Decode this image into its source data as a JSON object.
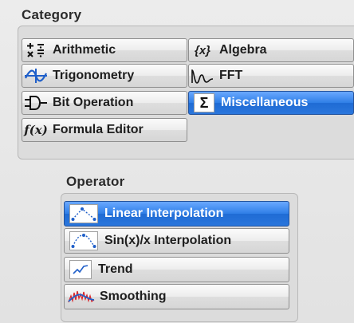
{
  "category": {
    "title": "Category",
    "buttons": [
      {
        "label": "Arithmetic",
        "icon": "arithmetic-icon",
        "selected": false
      },
      {
        "label": "Algebra",
        "icon": "algebra-icon",
        "icon_text": "{x}",
        "selected": false
      },
      {
        "label": "Trigonometry",
        "icon": "sine-wave-icon",
        "selected": false
      },
      {
        "label": "FFT",
        "icon": "fft-icon",
        "selected": false
      },
      {
        "label": "Bit Operation",
        "icon": "logic-gate-icon",
        "selected": false
      },
      {
        "label": "Miscellaneous",
        "icon": "sigma-icon",
        "icon_text": "Σ",
        "selected": true
      },
      {
        "label": "Formula Editor",
        "icon": "formula-icon",
        "icon_text": "f(x)",
        "selected": false
      }
    ]
  },
  "operator": {
    "title": "Operator",
    "buttons": [
      {
        "label": "Linear Interpolation",
        "icon": "linear-interpolation-icon",
        "selected": true
      },
      {
        "label": "Sin(x)/x Interpolation",
        "icon": "sinx-interpolation-icon",
        "selected": false
      },
      {
        "label": "Trend",
        "icon": "trend-icon",
        "selected": false
      },
      {
        "label": "Smoothing",
        "icon": "smoothing-icon",
        "selected": false
      }
    ]
  },
  "colors": {
    "selected": "#2f7ee6",
    "button": "#e6e6e6",
    "icon_blue": "#1f5fc9",
    "icon_red": "#d8262b"
  }
}
